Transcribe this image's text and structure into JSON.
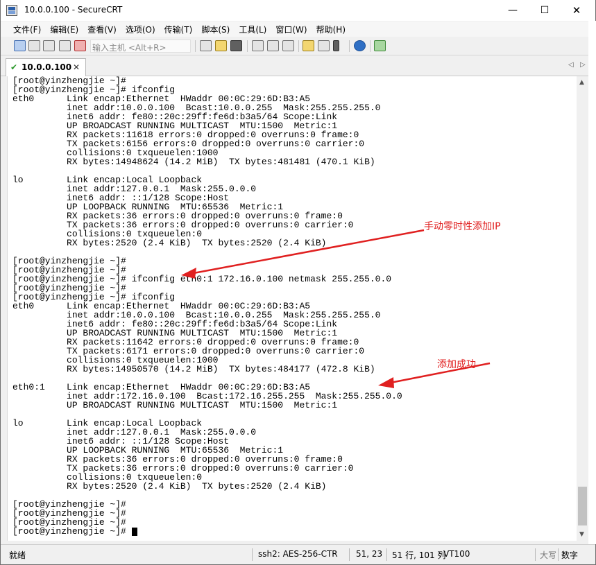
{
  "window": {
    "title": "10.0.0.100 - SecureCRT",
    "minimize_glyph": "—",
    "maximize_glyph": "☐",
    "close_glyph": "✕"
  },
  "menu": [
    "文件(F)",
    "编辑(E)",
    "查看(V)",
    "选项(O)",
    "传输(T)",
    "脚本(S)",
    "工具(L)",
    "窗口(W)",
    "帮助(H)"
  ],
  "toolbar": {
    "host_placeholder": "输入主机 <Alt+R>",
    "icons": [
      "connect-icon",
      "quick-connect-icon",
      "connect-tab-icon",
      "reconnect-icon",
      "disconnect-icon",
      "copy-icon",
      "paste-icon",
      "find-icon",
      "print-icon",
      "print-setup-icon",
      "map-keys-icon",
      "session-options-icon",
      "global-options-icon",
      "keymap-icon",
      "help-icon",
      "sftp-icon"
    ]
  },
  "tab": {
    "label": "10.0.0.100",
    "close_glyph": "✕",
    "scroll_left": "◁",
    "scroll_right": "▷"
  },
  "terminal": {
    "lines": [
      "[root@yinzhengjie ~]#",
      "[root@yinzhengjie ~]# ifconfig",
      "eth0      Link encap:Ethernet  HWaddr 00:0C:29:6D:B3:A5",
      "          inet addr:10.0.0.100  Bcast:10.0.0.255  Mask:255.255.255.0",
      "          inet6 addr: fe80::20c:29ff:fe6d:b3a5/64 Scope:Link",
      "          UP BROADCAST RUNNING MULTICAST  MTU:1500  Metric:1",
      "          RX packets:11618 errors:0 dropped:0 overruns:0 frame:0",
      "          TX packets:6156 errors:0 dropped:0 overruns:0 carrier:0",
      "          collisions:0 txqueuelen:1000",
      "          RX bytes:14948624 (14.2 MiB)  TX bytes:481481 (470.1 KiB)",
      "",
      "lo        Link encap:Local Loopback",
      "          inet addr:127.0.0.1  Mask:255.0.0.0",
      "          inet6 addr: ::1/128 Scope:Host",
      "          UP LOOPBACK RUNNING  MTU:65536  Metric:1",
      "          RX packets:36 errors:0 dropped:0 overruns:0 frame:0",
      "          TX packets:36 errors:0 dropped:0 overruns:0 carrier:0",
      "          collisions:0 txqueuelen:0",
      "          RX bytes:2520 (2.4 KiB)  TX bytes:2520 (2.4 KiB)",
      "",
      "[root@yinzhengjie ~]#",
      "[root@yinzhengjie ~]#",
      "[root@yinzhengjie ~]# ifconfig eth0:1 172.16.0.100 netmask 255.255.0.0",
      "[root@yinzhengjie ~]#",
      "[root@yinzhengjie ~]# ifconfig",
      "eth0      Link encap:Ethernet  HWaddr 00:0C:29:6D:B3:A5",
      "          inet addr:10.0.0.100  Bcast:10.0.0.255  Mask:255.255.255.0",
      "          inet6 addr: fe80::20c:29ff:fe6d:b3a5/64 Scope:Link",
      "          UP BROADCAST RUNNING MULTICAST  MTU:1500  Metric:1",
      "          RX packets:11642 errors:0 dropped:0 overruns:0 frame:0",
      "          TX packets:6171 errors:0 dropped:0 overruns:0 carrier:0",
      "          collisions:0 txqueuelen:1000",
      "          RX bytes:14950570 (14.2 MiB)  TX bytes:484177 (472.8 KiB)",
      "",
      "eth0:1    Link encap:Ethernet  HWaddr 00:0C:29:6D:B3:A5",
      "          inet addr:172.16.0.100  Bcast:172.16.255.255  Mask:255.255.0.0",
      "          UP BROADCAST RUNNING MULTICAST  MTU:1500  Metric:1",
      "",
      "lo        Link encap:Local Loopback",
      "          inet addr:127.0.0.1  Mask:255.0.0.0",
      "          inet6 addr: ::1/128 Scope:Host",
      "          UP LOOPBACK RUNNING  MTU:65536  Metric:1",
      "          RX packets:36 errors:0 dropped:0 overruns:0 frame:0",
      "          TX packets:36 errors:0 dropped:0 overruns:0 carrier:0",
      "          collisions:0 txqueuelen:0",
      "          RX bytes:2520 (2.4 KiB)  TX bytes:2520 (2.4 KiB)",
      "",
      "[root@yinzhengjie ~]#",
      "[root@yinzhengjie ~]#",
      "[root@yinzhengjie ~]#",
      "[root@yinzhengjie ~]# "
    ],
    "annotation_temp_ip": "手动零时性添加IP",
    "annotation_success": "添加成功",
    "annotation_color": "#e02020"
  },
  "scrollbar": {
    "up_glyph": "▲",
    "down_glyph": "▼"
  },
  "status": {
    "ready": "就绪",
    "cipher": "ssh2: AES-256-CTR",
    "cursor_pos": "51,  23",
    "rows_cols": "51 行, 101 列",
    "term_type": "VT100",
    "caps": "大写",
    "num": "数字"
  }
}
